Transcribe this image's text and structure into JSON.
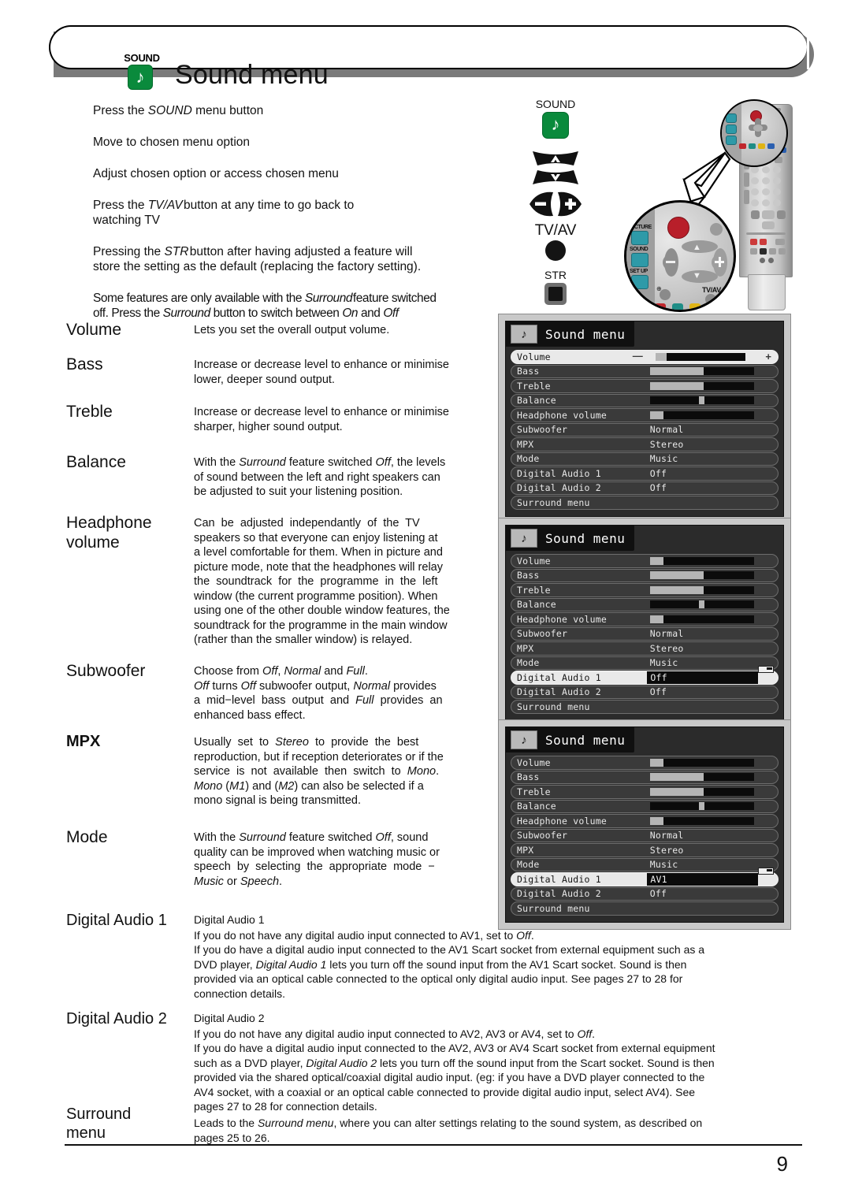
{
  "header": {
    "icon_label": "SOUND",
    "icon_name": "music-note-icon",
    "title": "Sound menu"
  },
  "intro_lines": [
    "Press the SOUND menu button",
    "Move to chosen menu option",
    "Adjust chosen option or access chosen menu",
    "Press the TV/AV button at any time to go back to watching TV",
    "Pressing the STR button after having adjusted a feature will store the setting as the default (replacing the factory setting).",
    "Some features are only available with the Surround feature switched off. Press the Surround button to switch between On and Off"
  ],
  "legend": {
    "sound_label": "SOUND",
    "tvav_label": "TV/AV",
    "str_label": "STR",
    "surround_icon": "surround-button-icon"
  },
  "remote": {
    "magnified_labels": [
      "PICTURE",
      "SOUND",
      "SET UP",
      "TV/AV"
    ]
  },
  "features": [
    {
      "name": "Volume",
      "desc_html": "Lets you set the overall output volume."
    },
    {
      "name": "Bass",
      "desc_html": "Increase or decrease level to enhance or minimise<br>lower, deeper sound output."
    },
    {
      "name": "Treble",
      "desc_html": "Increase or decrease level to enhance or minimise<br>sharper, higher sound output."
    },
    {
      "name": "Balance",
      "desc_html": "With the <i>Surround</i> feature switched <i>Off</i>, the levels<br>of sound between the left and right speakers can<br>be adjusted to suit your listening position."
    },
    {
      "name": "Headphone volume",
      "desc_html": "Can&nbsp; be&nbsp; adjusted&nbsp; independantly&nbsp; of&nbsp; the&nbsp; TV<br>speakers so that everyone can enjoy listening at<br>a level comfortable for them. When in picture and<br>picture mode, note that the headphones will relay<br>the&nbsp; soundtrack&nbsp; for&nbsp; the&nbsp; programme&nbsp; in&nbsp; the&nbsp; left<br>window (the current programme position). When<br>using one of the other double window features, the<br>soundtrack for the programme in the main window<br>(rather than the smaller window) is relayed."
    },
    {
      "name": "Subwoofer",
      "desc_html": "Choose from <i>Off</i>, <i>Normal</i> and <i>Full</i>.<br><i>Off</i> turns <i>Off</i> subwoofer output, <i>Normal</i> provides<br>a&nbsp; mid&#8722;level&nbsp; bass&nbsp; output&nbsp; and&nbsp; <i>Full</i>&nbsp; provides&nbsp; an<br>enhanced bass effect."
    },
    {
      "name": "MPX",
      "desc_html": "Usually&nbsp; set&nbsp; to&nbsp; <i>Stereo</i>&nbsp; to&nbsp; provide&nbsp; the&nbsp; best<br>reproduction, but if reception deteriorates or if the<br>service&nbsp; is&nbsp; not&nbsp; available&nbsp; then&nbsp; switch&nbsp; to&nbsp; <i>Mono</i>.<br><i>Mono</i> (<i>M1</i>) and (<i>M2</i>) can also be selected if a<br>mono signal is being transmitted."
    },
    {
      "name": "Mode",
      "desc_html": "With the <i>Surround</i> feature switched <i>Off</i>, sound<br>quality can be improved when watching music or<br>speech&nbsp; by&nbsp; selecting&nbsp; the&nbsp; appropriate&nbsp; mode&nbsp; &#8722;<br><i>Music</i> or <i>Speech</i>."
    }
  ],
  "wide_blocks": [
    {
      "name": "Digital Audio 1",
      "title": "Digital Audio 1",
      "body_html": "If you do not have any digital audio input connected to AV1, set to <i>Off</i>.<br>If you do have a digital audio input connected to the AV1 Scart socket from external equipment such as a<br>DVD player, <i>Digital Audio 1</i> lets you turn off the sound input from the AV1 Scart socket. Sound is then<br>provided via an optical cable connected to the optical only digital audio input. See pages 27 to 28 for<br>connection details."
    },
    {
      "name": "Digital Audio 2",
      "title": "Digital Audio 2",
      "body_html": "If you do not have any digital audio input connected to AV2, AV3 or AV4, set to <i>Off</i>.<br>If you do have a digital audio input connected to the AV2, AV3 or AV4 Scart socket from external equipment<br>such as a DVD player, <i>Digital Audio 2</i> lets you turn off the sound input from the Scart socket. Sound is then<br>provided via the shared optical/coaxial digital audio input. (eg: if you have a DVD player connected to the<br>AV4 socket, with a coaxial or an optical cable connected to provide digital audio input, select AV4). See<br>pages 27 to 28 for connection details."
    },
    {
      "name": "Surround menu",
      "title": "",
      "body_html": "Leads to the <i>Surround menu</i>, where you can alter settings relating to the sound system, as described on<br>pages 25 to 26."
    }
  ],
  "osd_screens": [
    {
      "title": "Sound menu",
      "rows": [
        {
          "label": "Volume",
          "type": "slider",
          "fill": 13,
          "selected": true,
          "volume_sel": true
        },
        {
          "label": "Bass",
          "type": "slider",
          "fill": 52
        },
        {
          "label": "Treble",
          "type": "slider",
          "fill": 52
        },
        {
          "label": "Balance",
          "type": "knob",
          "pos": 50
        },
        {
          "label": "Headphone volume",
          "type": "slider",
          "fill": 13
        },
        {
          "label": "Subwoofer",
          "type": "value",
          "value": "Normal"
        },
        {
          "label": "MPX",
          "type": "value",
          "value": "Stereo"
        },
        {
          "label": "Mode",
          "type": "value",
          "value": "Music"
        },
        {
          "label": "Digital Audio 1",
          "type": "value",
          "value": "Off"
        },
        {
          "label": "Digital Audio 2",
          "type": "value",
          "value": "Off"
        },
        {
          "label": "Surround menu",
          "type": "value",
          "value": ""
        }
      ]
    },
    {
      "title": "Sound menu",
      "rows": [
        {
          "label": "Volume",
          "type": "slider",
          "fill": 13
        },
        {
          "label": "Bass",
          "type": "slider",
          "fill": 52
        },
        {
          "label": "Treble",
          "type": "slider",
          "fill": 52
        },
        {
          "label": "Balance",
          "type": "knob",
          "pos": 50
        },
        {
          "label": "Headphone volume",
          "type": "slider",
          "fill": 13
        },
        {
          "label": "Subwoofer",
          "type": "value",
          "value": "Normal"
        },
        {
          "label": "MPX",
          "type": "value",
          "value": "Stereo"
        },
        {
          "label": "Mode",
          "type": "value",
          "value": "Music"
        },
        {
          "label": "Digital Audio 1",
          "type": "valuebox",
          "value": "Off",
          "selected": true,
          "pip": true
        },
        {
          "label": "Digital Audio 2",
          "type": "value",
          "value": "Off"
        },
        {
          "label": "Surround menu",
          "type": "value",
          "value": ""
        }
      ]
    },
    {
      "title": "Sound menu",
      "rows": [
        {
          "label": "Volume",
          "type": "slider",
          "fill": 13
        },
        {
          "label": "Bass",
          "type": "slider",
          "fill": 52
        },
        {
          "label": "Treble",
          "type": "slider",
          "fill": 52
        },
        {
          "label": "Balance",
          "type": "knob",
          "pos": 50
        },
        {
          "label": "Headphone volume",
          "type": "slider",
          "fill": 13
        },
        {
          "label": "Subwoofer",
          "type": "value",
          "value": "Normal"
        },
        {
          "label": "MPX",
          "type": "value",
          "value": "Stereo"
        },
        {
          "label": "Mode",
          "type": "value",
          "value": "Music"
        },
        {
          "label": "Digital Audio 1",
          "type": "valuebox",
          "value": "AV1",
          "selected": true,
          "pip": true
        },
        {
          "label": "Digital Audio 2",
          "type": "value",
          "value": "Off"
        },
        {
          "label": "Surround menu",
          "type": "value",
          "value": ""
        }
      ]
    }
  ],
  "footer": {
    "page_number": "9"
  },
  "colors": {
    "sound_green": "#0a8a3c",
    "osd_panel": "#c9c9c9",
    "osd_dark": "#2b2b2b",
    "osd_row": "#3a3a3a",
    "osd_bar_fill": "#b5b5b5"
  }
}
